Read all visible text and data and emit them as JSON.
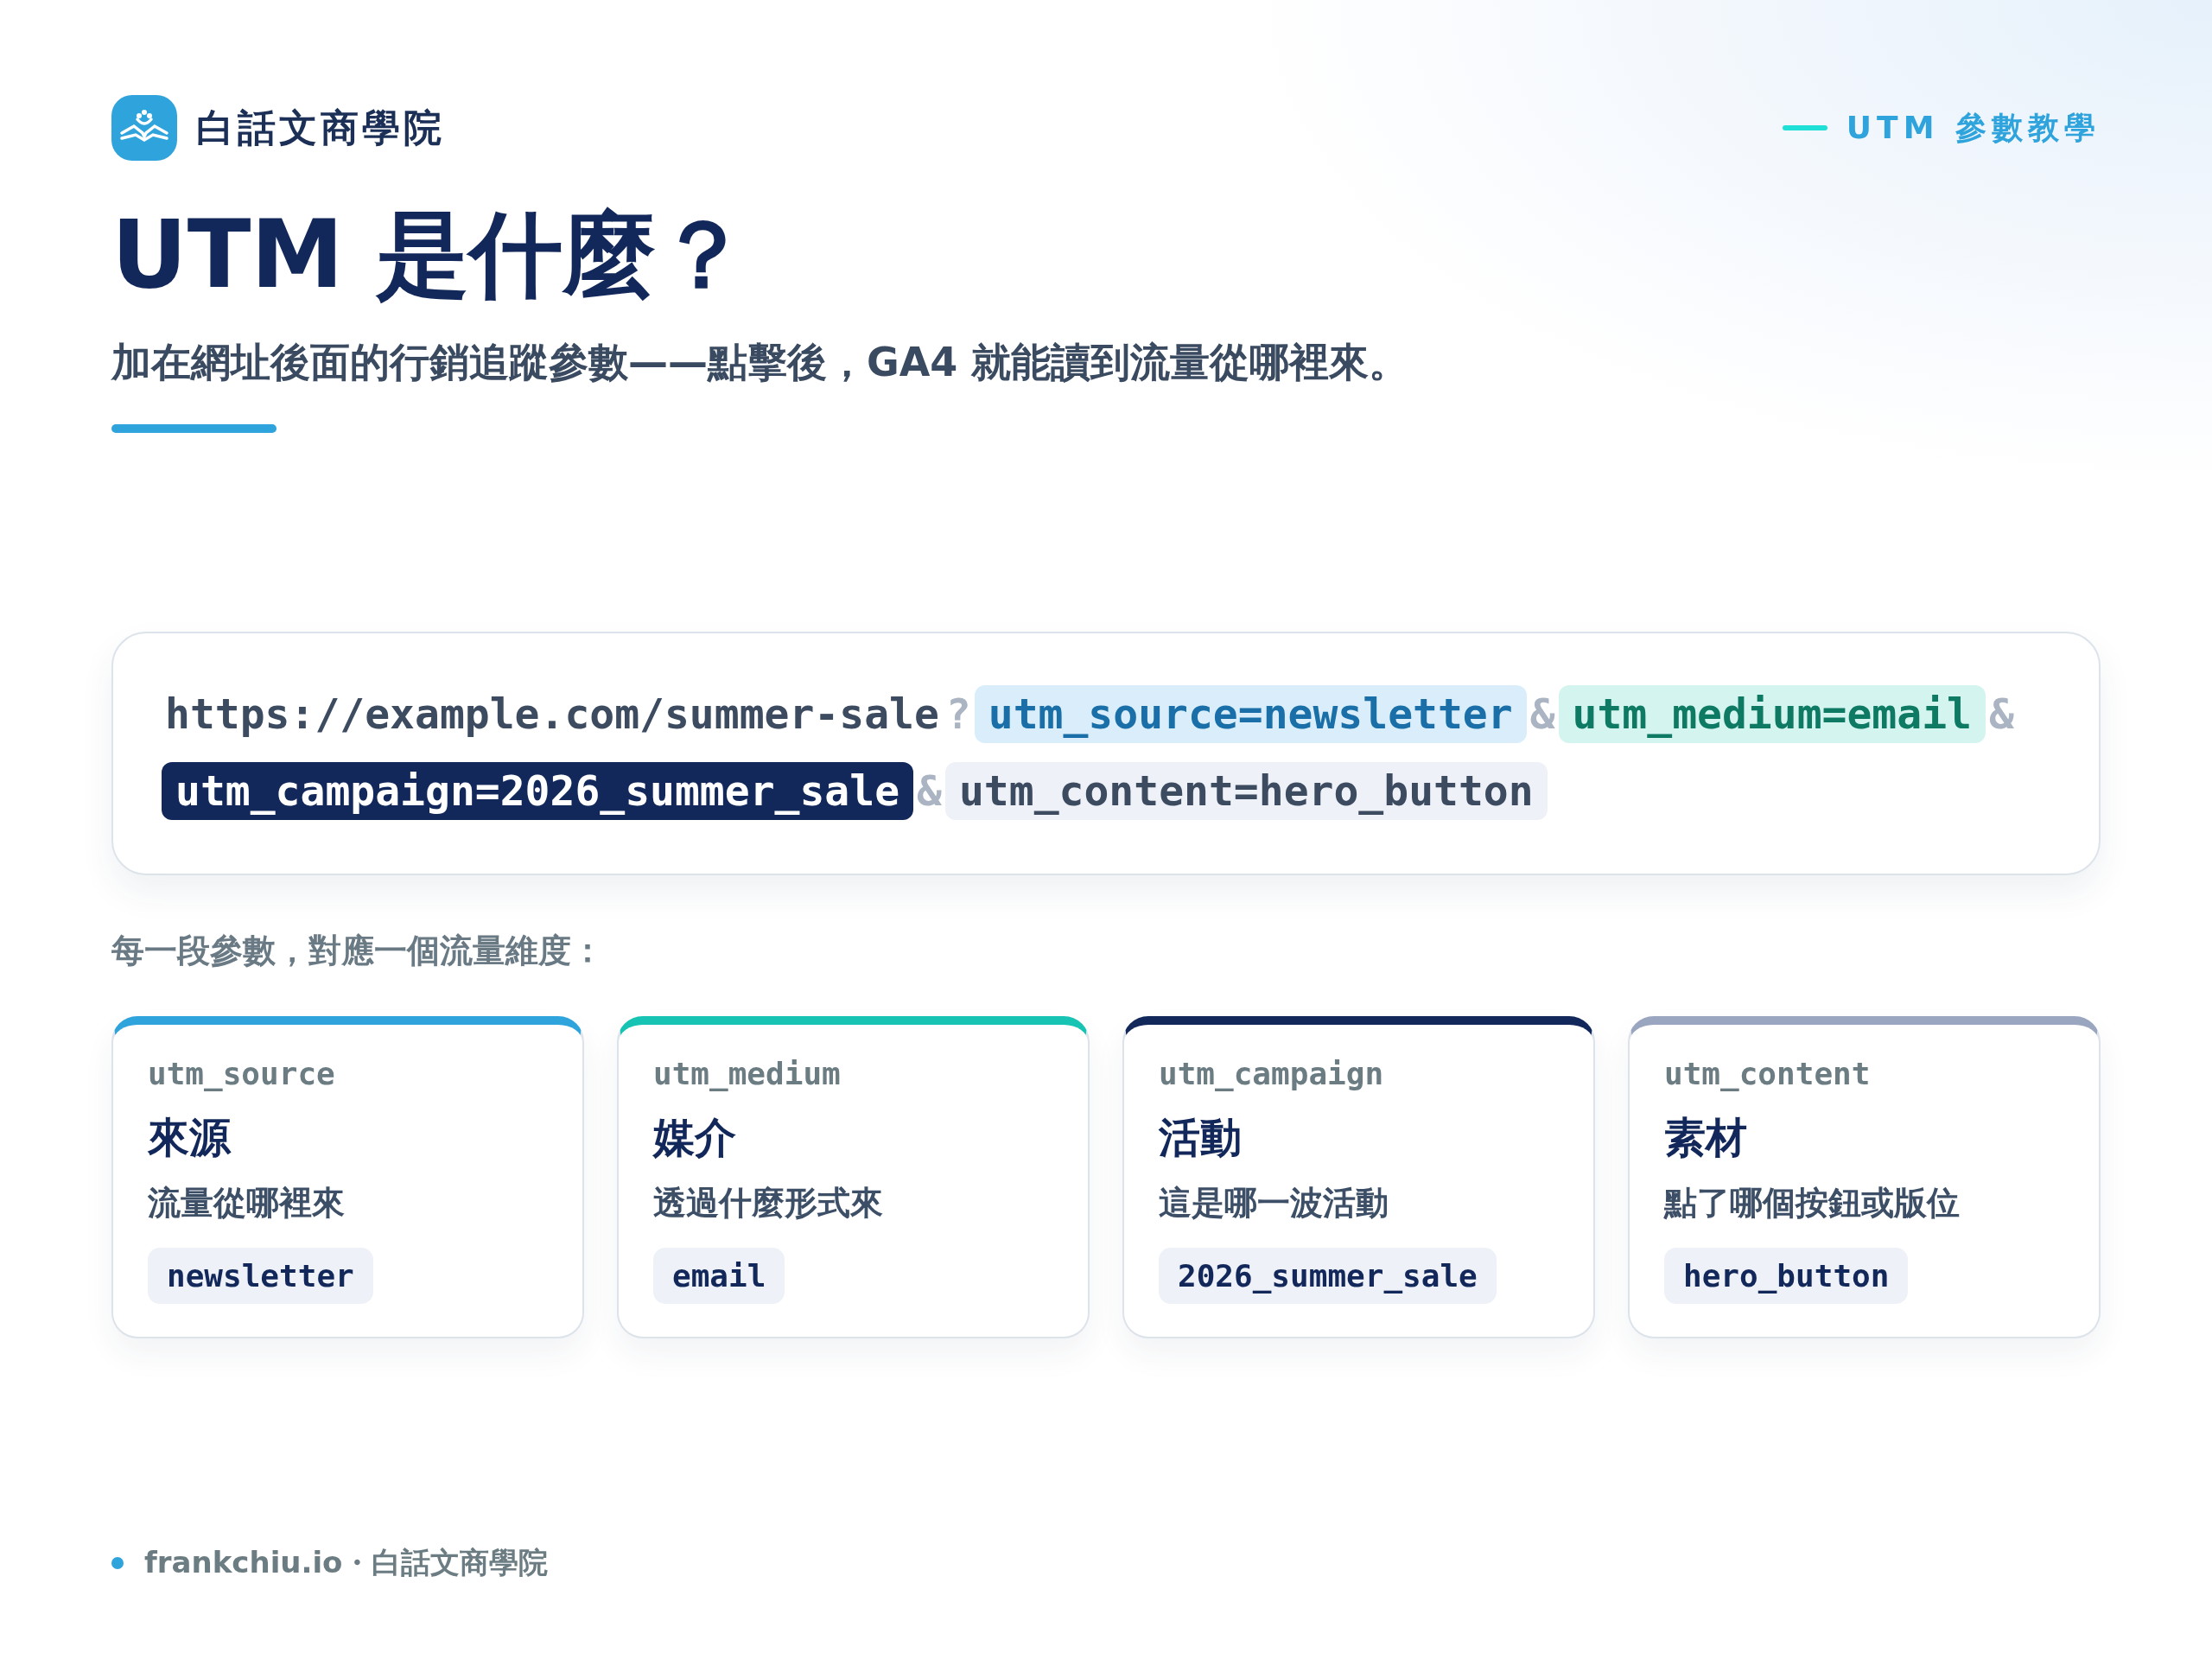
{
  "brand": {
    "name": "白話文商學院"
  },
  "tag": {
    "label": "UTM 參數教學"
  },
  "title": "UTM 是什麼？",
  "subtitle": "加在網址後面的行銷追蹤參數——點擊後，GA4 就能讀到流量從哪裡來。",
  "url": {
    "lines": [
      [
        {
          "kind": "plain",
          "text": "https://example.com/summer-sale"
        },
        {
          "kind": "sep",
          "text": "?"
        },
        {
          "kind": "source",
          "text": "utm_source=newsletter"
        },
        {
          "kind": "sep",
          "text": "&"
        },
        {
          "kind": "medium",
          "text": "utm_medium=email"
        },
        {
          "kind": "sep",
          "text": "&"
        }
      ],
      [
        {
          "kind": "campaign",
          "text": "utm_campaign=2026_summer_sale"
        },
        {
          "kind": "sep",
          "text": "&"
        },
        {
          "kind": "content",
          "text": "utm_content=hero_button"
        }
      ]
    ]
  },
  "caption": "每一段參數，對應一個流量維度：",
  "cards": [
    {
      "key": "utm_source",
      "title": "來源",
      "desc": "流量從哪裡來",
      "value": "newsletter",
      "color": "#2fa3dc"
    },
    {
      "key": "utm_medium",
      "title": "媒介",
      "desc": "透過什麼形式來",
      "value": "email",
      "color": "#17c3b2"
    },
    {
      "key": "utm_campaign",
      "title": "活動",
      "desc": "這是哪一波活動",
      "value": "2026_summer_sale",
      "color": "#13285a"
    },
    {
      "key": "utm_content",
      "title": "素材",
      "desc": "點了哪個按鈕或版位",
      "value": "hero_button",
      "color": "#9aa5c0"
    }
  ],
  "footer": {
    "site": "frankchiu.io",
    "sep": "・",
    "name": "白話文商學院"
  }
}
